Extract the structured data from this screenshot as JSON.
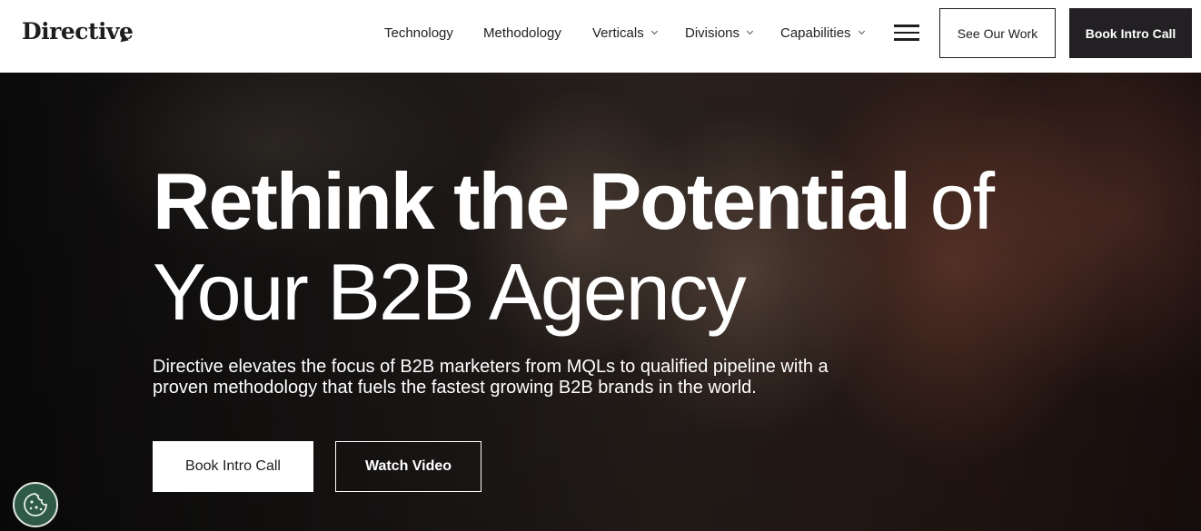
{
  "header": {
    "logo_text": "Directive",
    "nav": [
      {
        "label": "Technology",
        "has_dropdown": false
      },
      {
        "label": "Methodology",
        "has_dropdown": false
      },
      {
        "label": "Verticals",
        "has_dropdown": true
      },
      {
        "label": "Divisions",
        "has_dropdown": true
      },
      {
        "label": "Capabilities",
        "has_dropdown": true
      }
    ],
    "menu_icon": "hamburger-menu-icon",
    "see_work_label": "See Our Work",
    "book_call_label": "Book Intro Call"
  },
  "hero": {
    "headline_bold": "Rethink the Potential",
    "headline_light_1": "of",
    "headline_light_2": "Your B2B Agency",
    "subtext": "Directive elevates the focus of B2B marketers from MQLs to qualified pipeline with a proven methodology that fuels the fastest growing B2B brands in the world.",
    "primary_cta": "Book Intro Call",
    "secondary_cta": "Watch Video"
  },
  "cookie_widget": {
    "icon": "cookie-icon"
  },
  "colors": {
    "dark": "#232024",
    "white": "#ffffff",
    "cookie_bg": "#2f5a47"
  }
}
